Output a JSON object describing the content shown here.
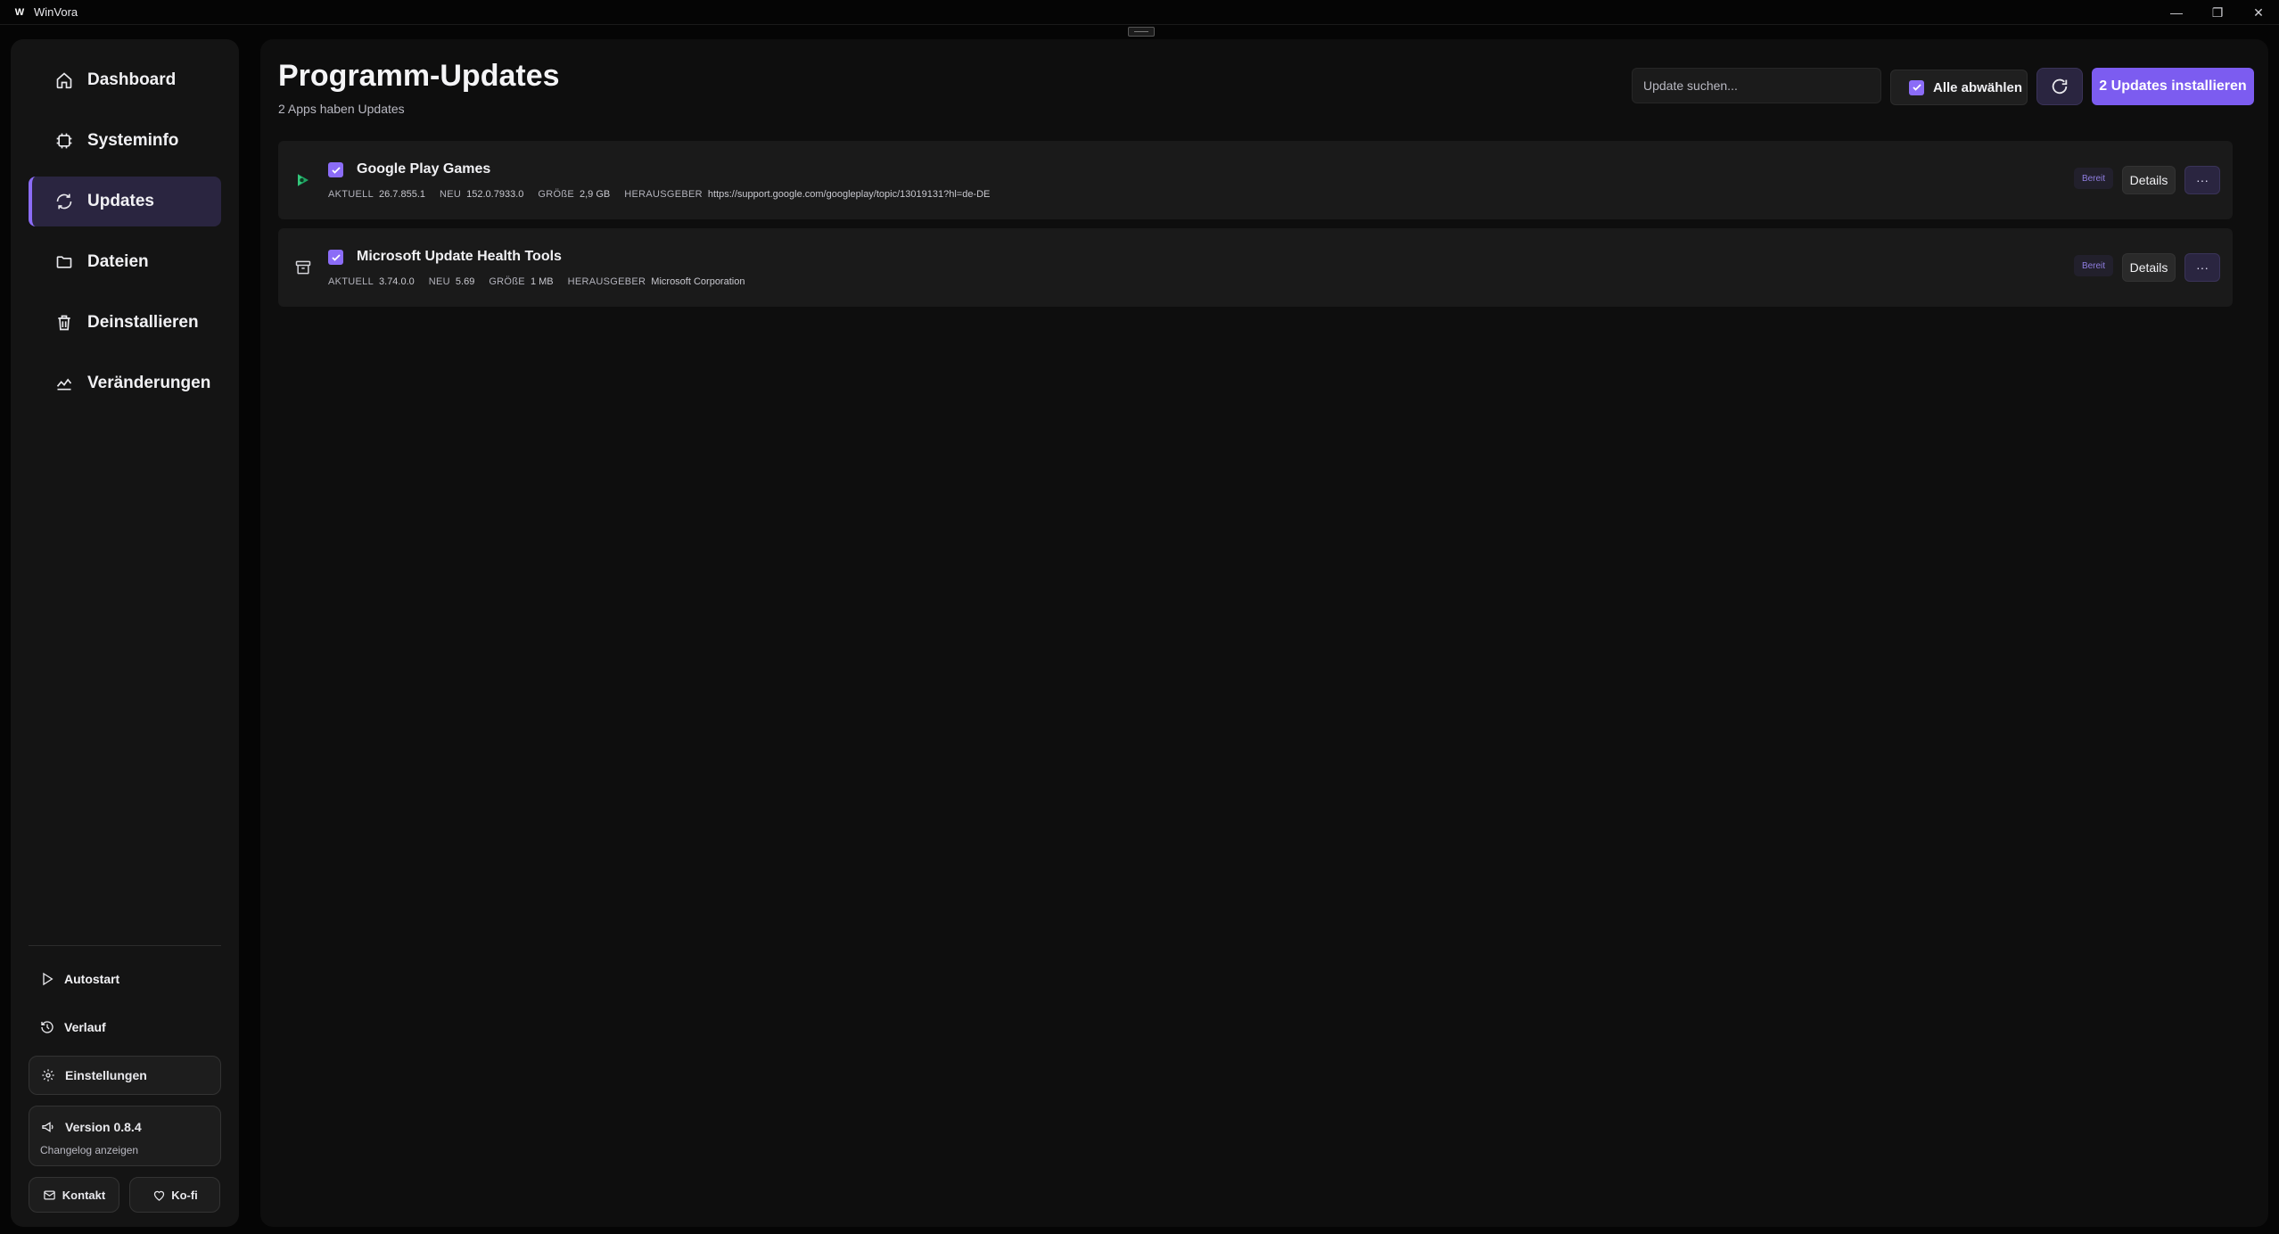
{
  "window": {
    "title": "WinVora",
    "logo_text": "W",
    "controls": {
      "minimize": "—",
      "restore": "❐",
      "close": "✕"
    }
  },
  "sidebar": {
    "nav": [
      {
        "label": "Dashboard",
        "icon": "home-icon"
      },
      {
        "label": "Systeminfo",
        "icon": "chip-icon"
      },
      {
        "label": "Updates",
        "icon": "refresh-icon",
        "active": true
      },
      {
        "label": "Dateien",
        "icon": "folder-icon"
      },
      {
        "label": "Deinstallieren",
        "icon": "trash-icon"
      },
      {
        "label": "Veränderungen",
        "icon": "chart-icon"
      }
    ],
    "autostart": "Autostart",
    "verlauf": "Verlauf",
    "settings": "Einstellungen",
    "version": "Version 0.8.4",
    "changelog": "Changelog anzeigen",
    "kontakt": "Kontakt",
    "kofi": "Ko-fi"
  },
  "main": {
    "title": "Programm-Updates",
    "subtitle": "2 Apps haben Updates",
    "search_placeholder": "Update suchen...",
    "select_all_label": "Alle abwählen",
    "install_label": "2 Updates installieren",
    "labels": {
      "current": "AKTUELL",
      "new": "NEU",
      "size": "GRÖßE",
      "publisher": "HERAUSGEBER",
      "status": "Bereit",
      "details": "Details",
      "more": "···"
    },
    "apps": [
      {
        "name": "Google Play Games",
        "current": "26.7.855.1",
        "new": "152.0.7933.0",
        "size": "2,9 GB",
        "publisher": "https://support.google.com/googleplay/topic/13019131?hl=de-DE"
      },
      {
        "name": "Microsoft Update Health Tools",
        "current": "3.74.0.0",
        "new": "5.69",
        "size": "1 MB",
        "publisher": "Microsoft Corporation"
      }
    ]
  },
  "colors": {
    "accent": "#7c5cf0",
    "accent_light": "#8b6cf7",
    "background": "#050505",
    "panel": "#141414"
  }
}
